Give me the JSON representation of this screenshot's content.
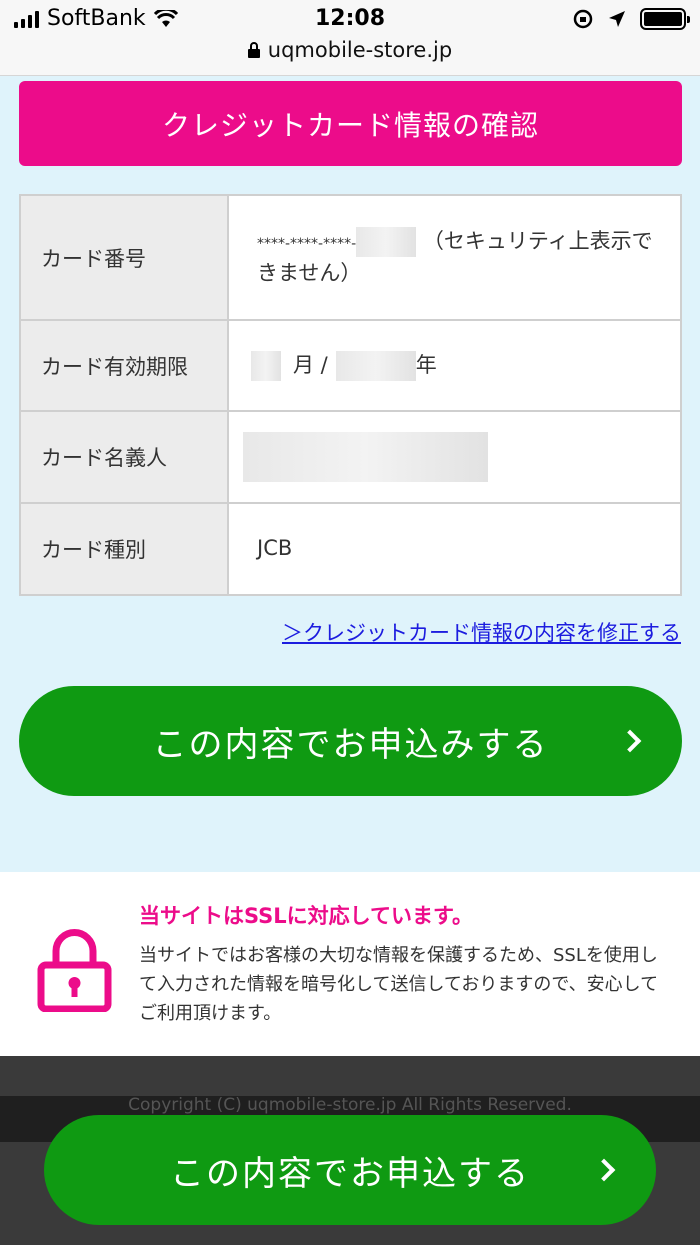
{
  "status_bar": {
    "carrier": "SoftBank",
    "time": "12:08",
    "url": "uqmobile-store.jp"
  },
  "header": {
    "title": "クレジットカード情報の確認"
  },
  "card_table": {
    "rows": [
      {
        "label": "カード番号",
        "value_prefix": "****-****-****-",
        "value_note": "（セキュリティ上表示できません）"
      },
      {
        "label": "カード有効期限",
        "month_unit": "月 /",
        "year_unit": "年"
      },
      {
        "label": "カード名義人"
      },
      {
        "label": "カード種別",
        "value": "JCB"
      }
    ]
  },
  "edit_link": "＞クレジットカード情報の内容を修正する",
  "apply_button": "この内容でお申込みする",
  "ssl": {
    "title": "当サイトはSSLに対応しています。",
    "text": "当サイトではお客様の大切な情報を保護するため、SSLを使用して入力された情報を暗号化して送信しておりますので、安心してご利用頂けます。"
  },
  "footer": {
    "copyright": "Copyright (C) uqmobile-store.jp All Rights Reserved."
  },
  "float_button": "この内容でお申込する",
  "colors": {
    "accent_pink": "#ec0c8a",
    "button_green": "#0f9a12",
    "background": "#dff3fb",
    "link_blue": "#1c1cdf"
  },
  "icons": [
    "wifi-icon",
    "lock-icon",
    "location-arrow-icon",
    "rotation-lock-icon",
    "battery-icon",
    "padlock-icon",
    "chevron-right-icon"
  ]
}
